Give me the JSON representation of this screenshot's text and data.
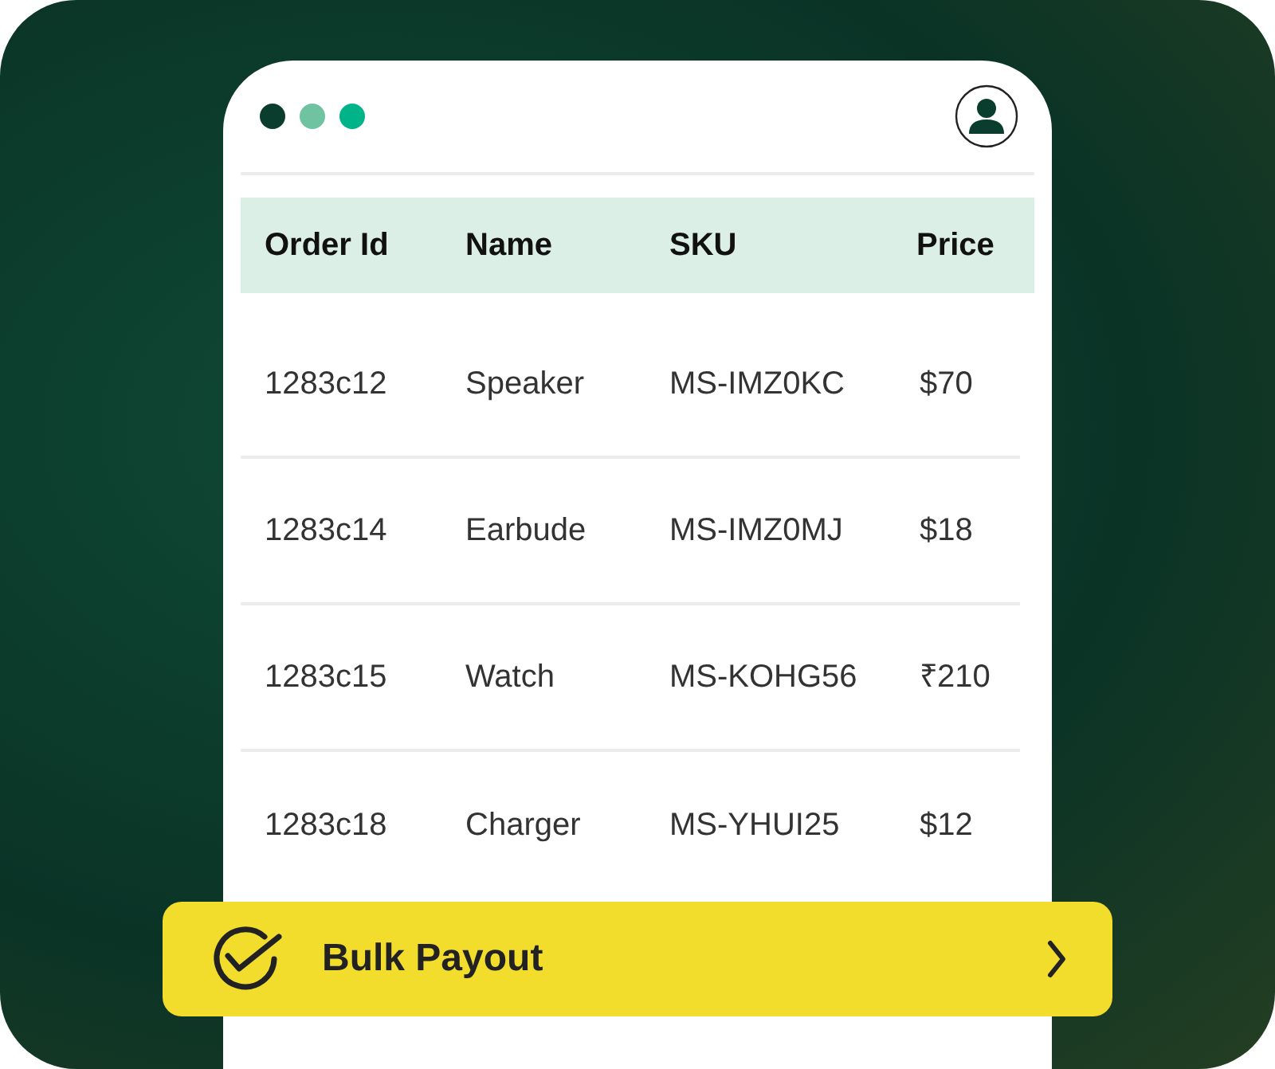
{
  "window_dots": [
    {
      "color": "#0b3d2e"
    },
    {
      "color": "#6fc3a0"
    },
    {
      "color": "#00b388"
    }
  ],
  "table": {
    "columns": [
      "Order Id",
      "Name",
      "SKU",
      "Price"
    ],
    "rows": [
      [
        "1283c12",
        "Speaker",
        "MS-IMZ0KC",
        "$70"
      ],
      [
        "1283c14",
        "Earbude",
        "MS-IMZ0MJ",
        "$18"
      ],
      [
        "1283c15",
        "Watch",
        "MS-KOHG56",
        "₹210"
      ],
      [
        "1283c18",
        "Charger",
        "MS-YHUI25",
        "$12"
      ]
    ]
  },
  "action_button": {
    "label": "Bulk Payout"
  }
}
